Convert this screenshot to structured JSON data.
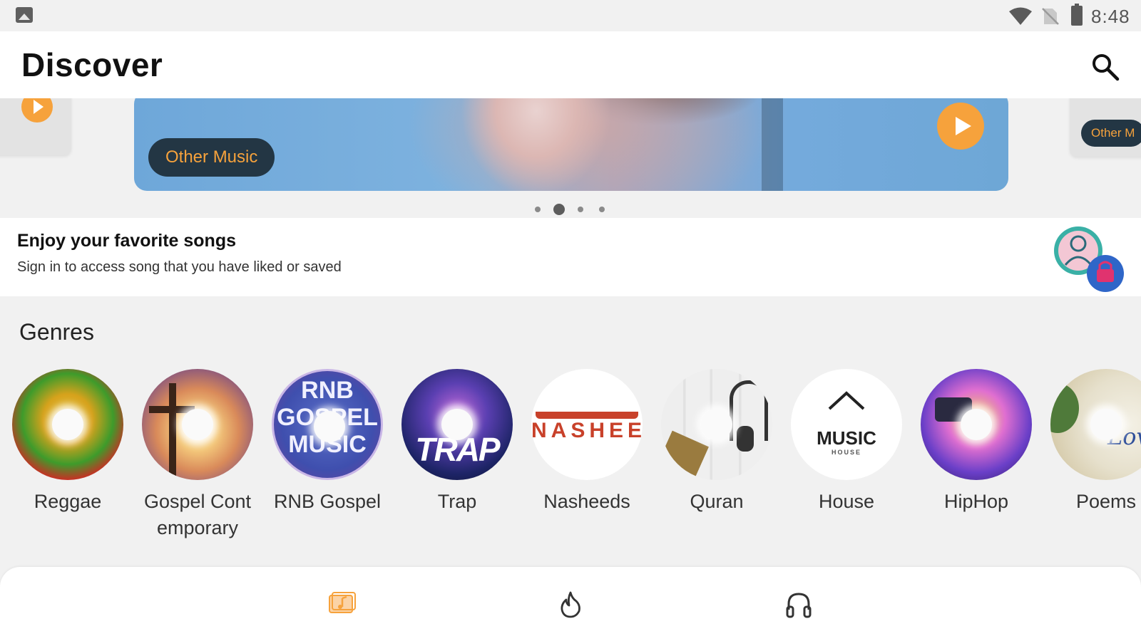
{
  "status_bar": {
    "time": "8:48"
  },
  "header": {
    "title": "Discover"
  },
  "carousel": {
    "main_card": {
      "tag": "Other Music"
    },
    "right_card": {
      "tag": "Other M"
    },
    "page_count": 4,
    "active_index": 1
  },
  "signin_banner": {
    "title": "Enjoy your favorite songs",
    "subtitle": "Sign in to access song that you have liked or saved"
  },
  "genres": {
    "title": "Genres",
    "items": [
      {
        "label": "Reggae"
      },
      {
        "label": "Gospel Cont emporary"
      },
      {
        "label": "RNB Gospel",
        "art_text": [
          "RNB",
          "GOSPEL",
          "MUSIC"
        ]
      },
      {
        "label": "Trap",
        "art_text": [
          "TRAP"
        ]
      },
      {
        "label": "Nasheeds",
        "art_text": [
          "NASHEED"
        ]
      },
      {
        "label": "Quran"
      },
      {
        "label": "House",
        "art_text": [
          "MUSIC",
          "HOUSE"
        ]
      },
      {
        "label": "HipHop"
      },
      {
        "label": "Poems"
      }
    ]
  },
  "bottom_nav": {
    "items": [
      {
        "icon": "music-library-icon",
        "active": true
      },
      {
        "icon": "trending-icon",
        "active": false
      },
      {
        "icon": "headphones-icon",
        "active": false
      }
    ]
  },
  "colors": {
    "accent": "#f6a23c",
    "tag_background": "#233644",
    "background": "#f1f1f1"
  }
}
